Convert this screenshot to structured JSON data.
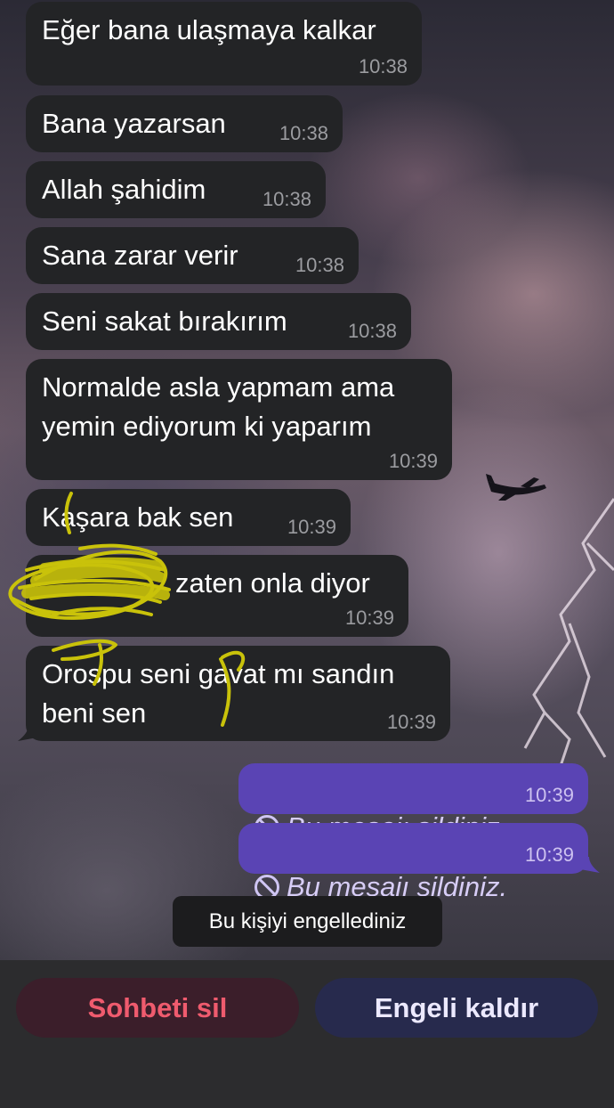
{
  "messages_incoming": [
    {
      "text": "Eğer bana ulaşmaya kalkar",
      "time": "10:38"
    },
    {
      "text": "Bana yazarsan",
      "time": "10:38"
    },
    {
      "text": "Allah şahidim",
      "time": "10:38"
    },
    {
      "text": "Sana zarar verir",
      "time": "10:38"
    },
    {
      "text": "Seni sakat bırakırım",
      "time": "10:38"
    },
    {
      "text": "Normalde asla yapmam ama\nyemin ediyorum ki yaparım",
      "time": "10:39"
    },
    {
      "text": "Kaşara bak sen",
      "time": "10:39"
    },
    {
      "text": "zaten onla diyor",
      "time": "10:39"
    },
    {
      "text": "Orospu seni gavat mı sandın\nbeni sen",
      "time": "10:39"
    }
  ],
  "messages_outgoing": [
    {
      "text": "Bu mesajı sildiniz.",
      "time": "10:39",
      "icon": "deleted-message-icon"
    },
    {
      "text": "Bu mesajı sildiniz.",
      "time": "10:39",
      "icon": "deleted-message-icon"
    }
  ],
  "system_notice": "Bu kişiyi engellediniz",
  "actions": {
    "delete_chat": "Sohbeti sil",
    "unblock": "Engeli kaldır"
  },
  "colors": {
    "incoming_bubble": "#232426",
    "outgoing_bubble": "#5a44b4",
    "delete_text": "#ef5b6e",
    "unblock_text": "#ece9ff",
    "scribble": "#c9c20a"
  }
}
